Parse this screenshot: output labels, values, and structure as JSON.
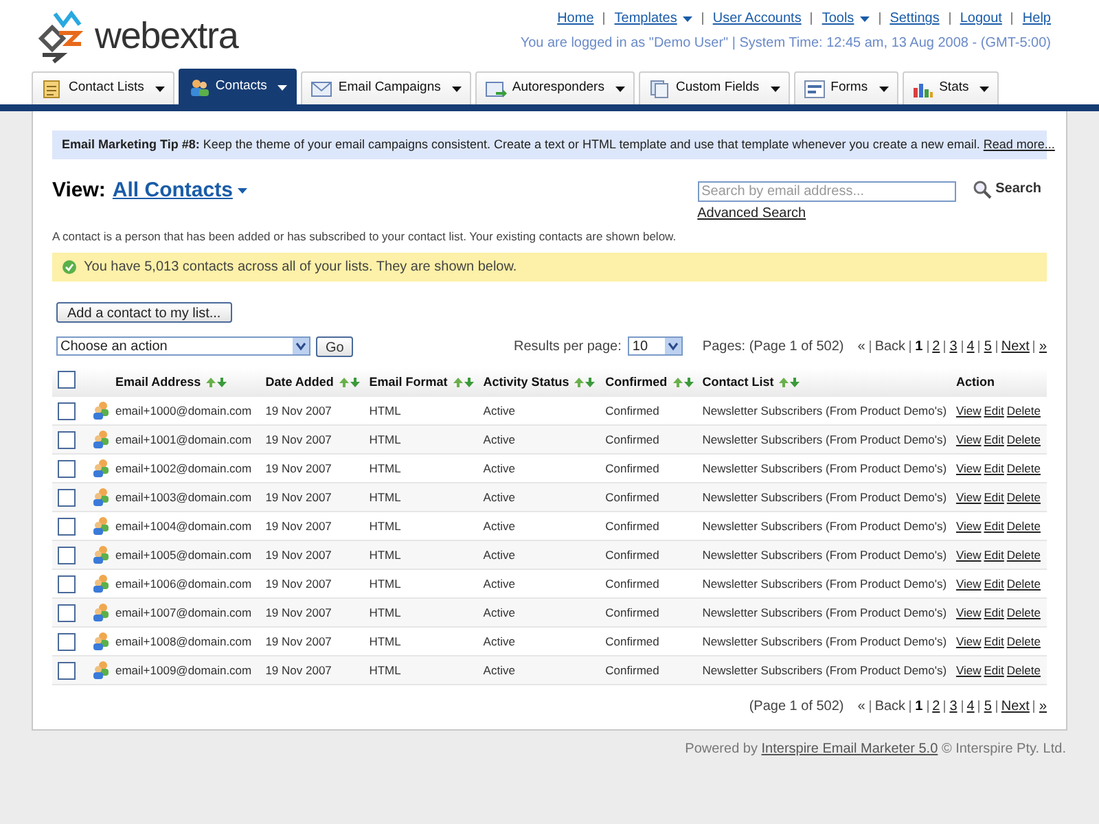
{
  "logo": {
    "text": "webextra"
  },
  "top_nav": [
    {
      "label": "Home",
      "has_menu": false
    },
    {
      "label": "Templates",
      "has_menu": true
    },
    {
      "label": "User Accounts",
      "has_menu": false
    },
    {
      "label": "Tools",
      "has_menu": true
    },
    {
      "label": "Settings",
      "has_menu": false
    },
    {
      "label": "Logout",
      "has_menu": false
    },
    {
      "label": "Help",
      "has_menu": false
    }
  ],
  "login_info": "You are logged in as \"Demo User\" | System Time: 12:45 am, 13 Aug 2008 - (GMT-5:00)",
  "tabs": [
    {
      "label": "Contact Lists",
      "selected": false
    },
    {
      "label": "Contacts",
      "selected": true
    },
    {
      "label": "Email Campaigns",
      "selected": false
    },
    {
      "label": "Autoresponders",
      "selected": false
    },
    {
      "label": "Custom Fields",
      "selected": false
    },
    {
      "label": "Forms",
      "selected": false
    },
    {
      "label": "Stats",
      "selected": false
    }
  ],
  "tip": {
    "title": "Email Marketing Tip #8:",
    "text": "Keep the theme of your email campaigns consistent. Create a text or HTML template and use that template whenever you create a new email.",
    "link": "Read more..."
  },
  "view": {
    "label": "View:",
    "value": "All Contacts"
  },
  "search": {
    "placeholder": "Search by email address...",
    "button": "Search",
    "advanced": "Advanced Search"
  },
  "description": "A contact is a person that has been added or has subscribed to your contact list. Your existing contacts are shown below.",
  "notice": "You have 5,013 contacts across all of your lists. They are shown below.",
  "add_button": "Add a contact to my list...",
  "action_select": {
    "value": "Choose an action",
    "button": "Go"
  },
  "results_per_page": {
    "label": "Results per page:",
    "value": "10"
  },
  "pages_label": "Pages: (Page 1 of 502)",
  "pagination": [
    {
      "text": "«",
      "kind": "text"
    },
    {
      "text": "Back",
      "kind": "text"
    },
    {
      "text": "1",
      "kind": "current"
    },
    {
      "text": "2",
      "kind": "link"
    },
    {
      "text": "3",
      "kind": "link"
    },
    {
      "text": "4",
      "kind": "link"
    },
    {
      "text": "5",
      "kind": "link"
    },
    {
      "text": "Next",
      "kind": "link"
    },
    {
      "text": "»",
      "kind": "link"
    }
  ],
  "table": {
    "select_all_checked": false,
    "columns": [
      {
        "label": "Email Address",
        "sortable": true
      },
      {
        "label": "Date Added",
        "sortable": true
      },
      {
        "label": "Email Format",
        "sortable": true
      },
      {
        "label": "Activity Status",
        "sortable": true
      },
      {
        "label": "Confirmed",
        "sortable": true
      },
      {
        "label": "Contact List",
        "sortable": true
      },
      {
        "label": "Action",
        "sortable": false
      }
    ],
    "rows": [
      {
        "checked": false,
        "email": "email+1000@domain.com",
        "date": "19 Nov 2007",
        "format": "HTML",
        "status": "Active",
        "confirmed": "Confirmed",
        "list": "Newsletter Subscribers (From Product Demo's)",
        "actions": [
          "View",
          "Edit",
          "Delete"
        ]
      },
      {
        "checked": false,
        "email": "email+1001@domain.com",
        "date": "19 Nov 2007",
        "format": "HTML",
        "status": "Active",
        "confirmed": "Confirmed",
        "list": "Newsletter Subscribers (From Product Demo's)",
        "actions": [
          "View",
          "Edit",
          "Delete"
        ]
      },
      {
        "checked": false,
        "email": "email+1002@domain.com",
        "date": "19 Nov 2007",
        "format": "HTML",
        "status": "Active",
        "confirmed": "Confirmed",
        "list": "Newsletter Subscribers (From Product Demo's)",
        "actions": [
          "View",
          "Edit",
          "Delete"
        ]
      },
      {
        "checked": false,
        "email": "email+1003@domain.com",
        "date": "19 Nov 2007",
        "format": "HTML",
        "status": "Active",
        "confirmed": "Confirmed",
        "list": "Newsletter Subscribers (From Product Demo's)",
        "actions": [
          "View",
          "Edit",
          "Delete"
        ]
      },
      {
        "checked": false,
        "email": "email+1004@domain.com",
        "date": "19 Nov 2007",
        "format": "HTML",
        "status": "Active",
        "confirmed": "Confirmed",
        "list": "Newsletter Subscribers (From Product Demo's)",
        "actions": [
          "View",
          "Edit",
          "Delete"
        ]
      },
      {
        "checked": false,
        "email": "email+1005@domain.com",
        "date": "19 Nov 2007",
        "format": "HTML",
        "status": "Active",
        "confirmed": "Confirmed",
        "list": "Newsletter Subscribers (From Product Demo's)",
        "actions": [
          "View",
          "Edit",
          "Delete"
        ]
      },
      {
        "checked": false,
        "email": "email+1006@domain.com",
        "date": "19 Nov 2007",
        "format": "HTML",
        "status": "Active",
        "confirmed": "Confirmed",
        "list": "Newsletter Subscribers (From Product Demo's)",
        "actions": [
          "View",
          "Edit",
          "Delete"
        ]
      },
      {
        "checked": false,
        "email": "email+1007@domain.com",
        "date": "19 Nov 2007",
        "format": "HTML",
        "status": "Active",
        "confirmed": "Confirmed",
        "list": "Newsletter Subscribers (From Product Demo's)",
        "actions": [
          "View",
          "Edit",
          "Delete"
        ]
      },
      {
        "checked": false,
        "email": "email+1008@domain.com",
        "date": "19 Nov 2007",
        "format": "HTML",
        "status": "Active",
        "confirmed": "Confirmed",
        "list": "Newsletter Subscribers (From Product Demo's)",
        "actions": [
          "View",
          "Edit",
          "Delete"
        ]
      },
      {
        "checked": false,
        "email": "email+1009@domain.com",
        "date": "19 Nov 2007",
        "format": "HTML",
        "status": "Active",
        "confirmed": "Confirmed",
        "list": "Newsletter Subscribers (From Product Demo's)",
        "actions": [
          "View",
          "Edit",
          "Delete"
        ]
      }
    ]
  },
  "bottom_pages_label": "(Page 1 of 502)",
  "bottom_pagination": [
    {
      "text": "«",
      "kind": "text"
    },
    {
      "text": "Back",
      "kind": "text"
    },
    {
      "text": "1",
      "kind": "current"
    },
    {
      "text": "2",
      "kind": "link"
    },
    {
      "text": "3",
      "kind": "link"
    },
    {
      "text": "4",
      "kind": "link"
    },
    {
      "text": "5",
      "kind": "link"
    },
    {
      "text": "Next",
      "kind": "link"
    },
    {
      "text": "»",
      "kind": "link"
    }
  ],
  "footer": {
    "prefix": "Powered by",
    "link": "Interspire Email Marketer 5.0",
    "suffix": "© Interspire Pty. Ltd."
  }
}
